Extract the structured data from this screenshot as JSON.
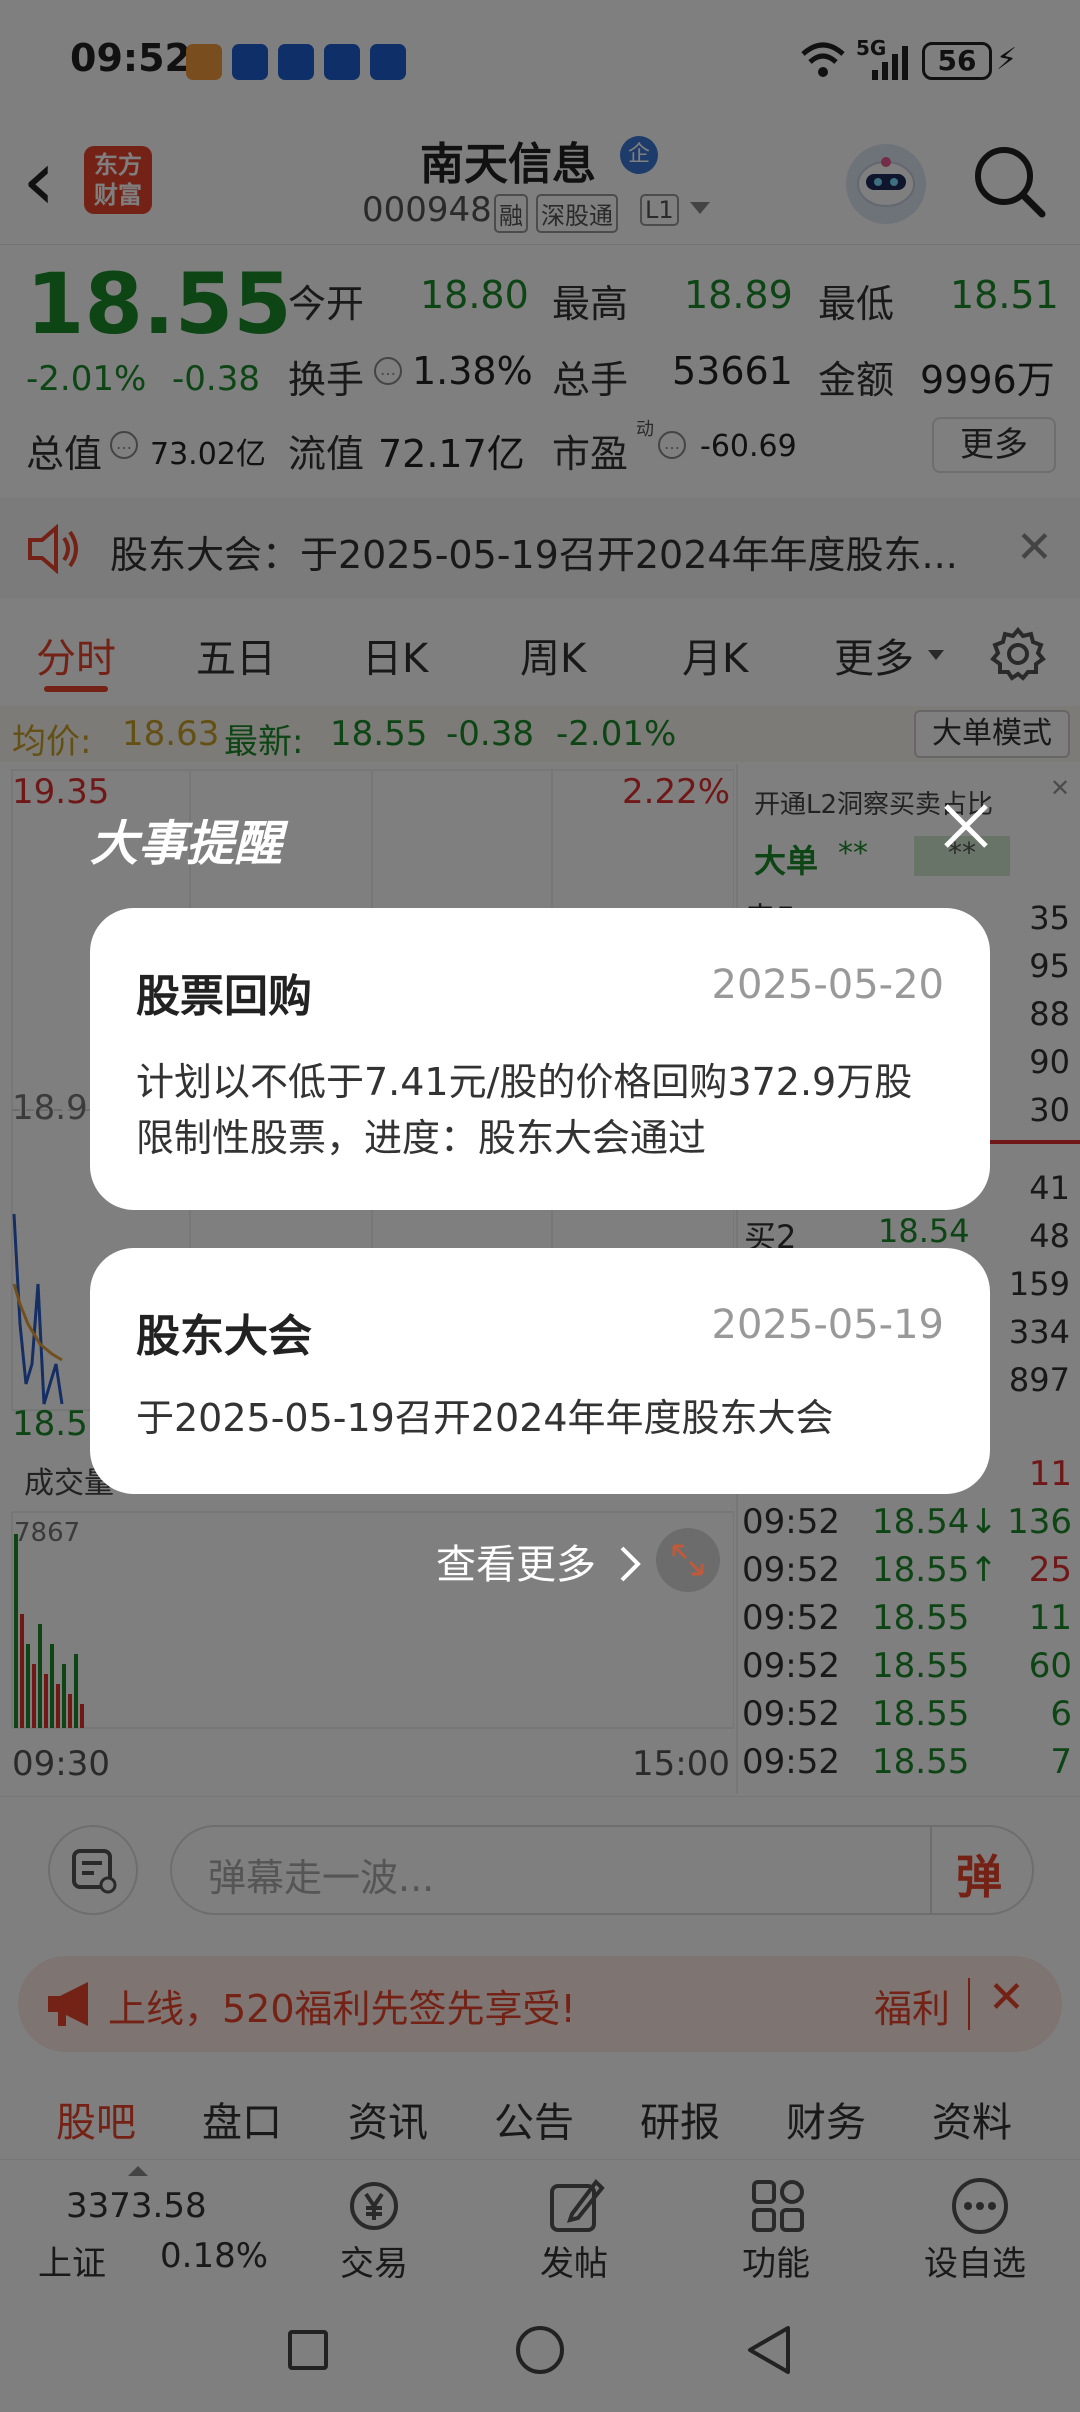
{
  "status": {
    "time": "09:52",
    "network": "5G",
    "battery": "56"
  },
  "header": {
    "back": "‹",
    "logo_line1": "东方",
    "logo_line2": "财富",
    "stock_name": "南天信息",
    "badge": "企",
    "stock_code": "000948",
    "tag_rong": "融",
    "tag_sgt": "深股通",
    "tag_l1": "L1"
  },
  "quote": {
    "price": "18.55",
    "change_pct": "-2.01%",
    "change": "-0.38",
    "open_label": "今开",
    "open": "18.80",
    "high_label": "最高",
    "high": "18.89",
    "low_label": "最低",
    "low": "18.51",
    "turnover_label": "换手",
    "turnover": "1.38%",
    "volume_label": "总手",
    "volume": "53661",
    "amount_label": "金额",
    "amount": "9996万",
    "total_value_label": "总值",
    "total_value": "73.02亿",
    "float_value_label": "流值",
    "float_value": "72.17亿",
    "pe_label": "市盈",
    "pe_sup": "动",
    "pe": "-60.69",
    "more": "更多"
  },
  "notice": {
    "text": "股东大会：于2025-05-19召开2024年年度股东..."
  },
  "chart_tabs": [
    "分时",
    "五日",
    "日K",
    "周K",
    "月K",
    "更多"
  ],
  "chart_info": {
    "avg_label": "均价:",
    "avg": "18.63",
    "latest_label": "最新:",
    "latest": "18.55",
    "change": "-0.38",
    "pct": "-2.01%",
    "big_order_mode": "大单模式"
  },
  "chart": {
    "top_price": "19.35",
    "top_pct": "2.22%",
    "mid_price": "18.9",
    "bottom_price": "18.5",
    "vol_label": "成交量",
    "vol_max": "7867",
    "start_time": "09:30",
    "end_time": "15:00"
  },
  "level2": {
    "promo": "开通L2洞察买卖占比",
    "big_label": "大单",
    "stars1": "**",
    "stars2": "**",
    "sell5": "卖5",
    "buy2": "买2",
    "buy2_price": "18.54",
    "qty": [
      "35",
      "95",
      "88",
      "90",
      "30",
      "41",
      "48",
      "159",
      "334",
      "897"
    ]
  },
  "ticks": [
    {
      "time": "",
      "price": "",
      "vol": "11"
    },
    {
      "time": "09:52",
      "price": "18.54↓",
      "vol": "136"
    },
    {
      "time": "09:52",
      "price": "18.55↑",
      "vol": "25"
    },
    {
      "time": "09:52",
      "price": "18.55",
      "vol": "11"
    },
    {
      "time": "09:52",
      "price": "18.55",
      "vol": "60"
    },
    {
      "time": "09:52",
      "price": "18.55",
      "vol": "6"
    },
    {
      "time": "09:52",
      "price": "18.55",
      "vol": "7"
    }
  ],
  "danmu": {
    "placeholder": "弹幕走一波...",
    "button": "弹"
  },
  "banner": {
    "text": "上线，520福利先签先享受!",
    "label": "福利"
  },
  "bottom_tabs": [
    "股吧",
    "盘口",
    "资讯",
    "公告",
    "研报",
    "财务",
    "资料"
  ],
  "dock": {
    "index_value": "3373.58",
    "index_name": "上证",
    "index_pct": "0.18%",
    "trade": "交易",
    "post": "发帖",
    "func": "功能",
    "watch": "设自选"
  },
  "modal": {
    "title": "大事提醒",
    "events": [
      {
        "title": "股票回购",
        "date": "2025-05-20",
        "body": "计划以不低于7.41元/股的价格回购372.9万股限制性股票，进度：股东大会通过"
      },
      {
        "title": "股东大会",
        "date": "2025-05-19",
        "body": "于2025-05-19召开2024年年度股东大会"
      }
    ],
    "more": "查看更多"
  },
  "colors": {
    "up": "#e03030",
    "down": "#1a8a2a",
    "brand": "#e8452c"
  }
}
